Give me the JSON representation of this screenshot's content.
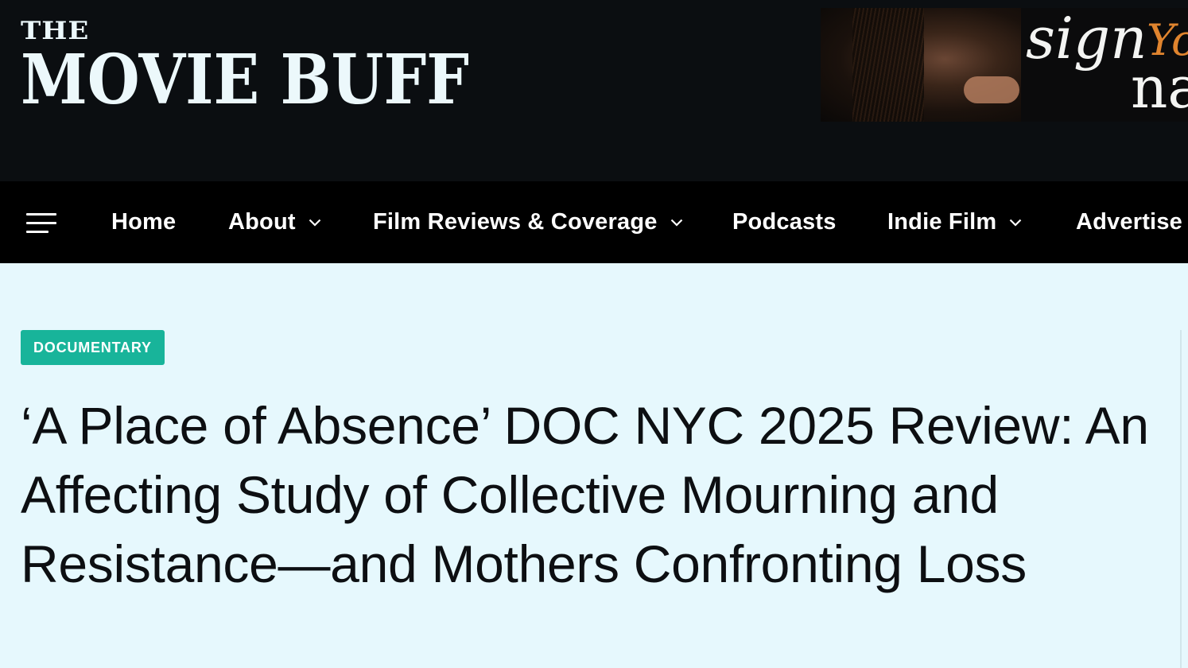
{
  "header": {
    "logo": {
      "top_text": "THE",
      "main_text": "MOVIE BUFF"
    },
    "ad": {
      "text_line1": "sign",
      "text_line2": "na",
      "accent_text": "Yo"
    }
  },
  "nav": {
    "menu_icon": "hamburger-menu-icon",
    "items": [
      {
        "label": "Home",
        "has_dropdown": false
      },
      {
        "label": "About",
        "has_dropdown": true
      },
      {
        "label": "Film Reviews & Coverage",
        "has_dropdown": true
      },
      {
        "label": "Podcasts",
        "has_dropdown": false
      },
      {
        "label": "Indie Film",
        "has_dropdown": true
      },
      {
        "label": "Advertise",
        "has_dropdown": false
      }
    ]
  },
  "article": {
    "category": "DOCUMENTARY",
    "title": "‘A Place of Absence’ DOC NYC 2025 Review: An Affecting Study of Collective Mourning and Resistance—and Mothers Confronting Loss"
  },
  "colors": {
    "header_bg": "#0b0e11",
    "nav_bg": "#000000",
    "page_bg": "#e6f8fd",
    "badge_bg": "#18b49a",
    "ad_accent": "#e0842e"
  }
}
